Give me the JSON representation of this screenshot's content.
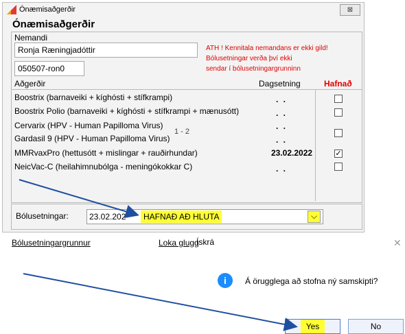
{
  "window": {
    "title": "Ónæmisaðgerðir",
    "close_glyph": "⊠",
    "heading": "Ónæmisaðgerðir"
  },
  "student": {
    "label": "Nemandi",
    "name": "Ronja Ræningjadóttir",
    "kennitala": "050507-ron0",
    "warning_lines": [
      "ATH ! Kennitala nemandans er ekki gild!",
      "Bólusetningar verða því ekki",
      "sendar í bólusetningargrunninn"
    ]
  },
  "table": {
    "col_procedure": "Aðgerðir",
    "col_date": "Dagsetning",
    "col_refused": "Hafnað",
    "rows": [
      {
        "name": "Boostrix (barnaveiki + kíghósti + stífkrampi)",
        "date": ". .",
        "checked": false
      },
      {
        "name": "Boostrix Polio (barnaveiki + kíghósti + stífkrampi + mænusótt)",
        "date": ". .",
        "checked": false
      },
      {
        "name": "Cervarix (HPV - Human Papilloma Virus)",
        "date": ". .",
        "checked": false
      },
      {
        "name": "Gardasil 9 (HPV - Human Papilloma Virus)",
        "date": ". .",
        "checked": false
      },
      {
        "name": "MMRvaxPro (hettusótt + mislingar + rauðirhundar)",
        "date": "23.02.2022",
        "checked": true
      },
      {
        "name": "NeicVac-C (heilahimnubólga - meningókokkar C)",
        "date": ". .",
        "checked": false
      }
    ],
    "range_label": "1 - 2"
  },
  "vaccination": {
    "label": "Bólusetningar:",
    "selected_date": "23.02.202",
    "selected_status": "HAFNAÐ AÐ HLUTA",
    "dropdown_glyph": "⌵"
  },
  "links": {
    "database": "Bólusetningargrunnur",
    "close_window": "Loka glugg",
    "register": "Ískrá"
  },
  "dialog": {
    "close_glyph": "✕",
    "info_glyph": "i",
    "message": "Á örugglega að stofna ný samskipti?",
    "yes": "Yes",
    "no": "No"
  },
  "colors": {
    "highlight": "#ffff33",
    "warning": "#e00000",
    "info": "#1a8cff",
    "arrow": "#1f4fa0"
  }
}
